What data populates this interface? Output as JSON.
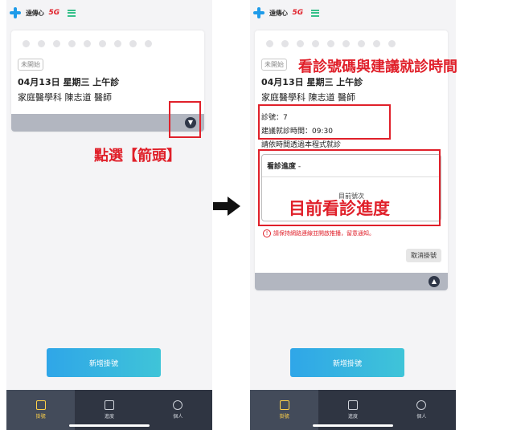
{
  "app": {
    "logo_text": "遠傳心",
    "logo_5g": "5G"
  },
  "left_screen": {
    "status": "未開始",
    "date_line": "04月13日 星期三 上午診",
    "doctor_line": "家庭醫學科 陳志道 醫師",
    "new_button": "新增掛號",
    "tabs": [
      {
        "label": "掛號"
      },
      {
        "label": "進度"
      },
      {
        "label": "個人"
      }
    ]
  },
  "right_screen": {
    "status": "未開始",
    "date_line": "04月13日 星期三 上午診",
    "doctor_line": "家庭醫學科 陳志道 醫師",
    "number_line": "診號：7",
    "suggest_time": "建議就診時間：09:30",
    "notice_line": "請依時間透過本程式就診",
    "progress_title": "看診進度",
    "progress_dash": " -",
    "current_number_label": "目前號次",
    "warning": "請保持網路連線並開啟推播，留意通知。",
    "cancel_button": "取消掛號",
    "new_button": "新增掛號",
    "tabs": [
      {
        "label": "掛號"
      },
      {
        "label": "進度"
      },
      {
        "label": "個人"
      }
    ]
  },
  "annotations": {
    "tap_arrow": "點選【箭頭】",
    "number_time": "看診號碼與建議就診時間",
    "current_progress": "目前看診進度"
  },
  "colors": {
    "annotation": "#e0202a",
    "accent_blue": "#2fa6e8",
    "tabbar": "#2f3542"
  }
}
